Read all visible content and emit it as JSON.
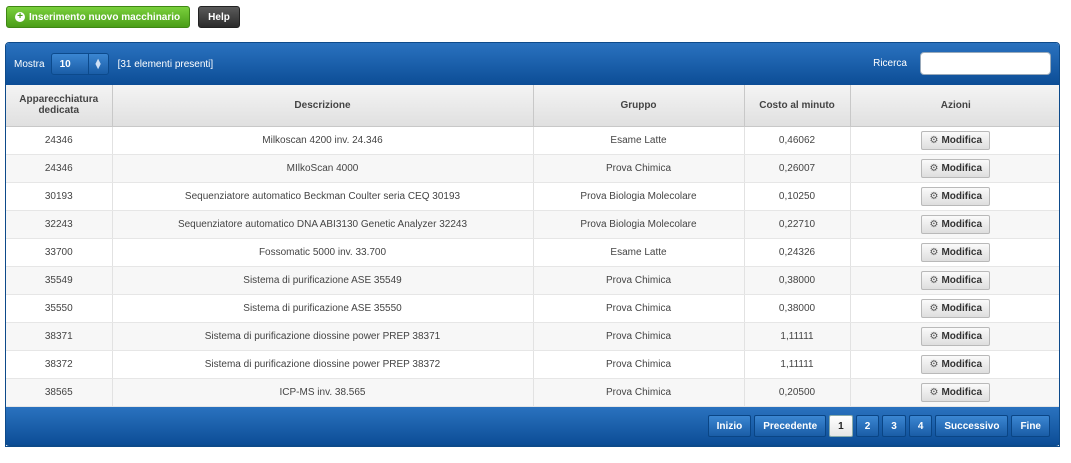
{
  "toolbar": {
    "insert_label": "Inserimento nuovo macchinario",
    "help_label": "Help"
  },
  "controls": {
    "show_label": "Mostra",
    "page_size": "10",
    "count_label": "[31 elementi presenti]",
    "search_label": "Ricerca",
    "search_value": ""
  },
  "table": {
    "headers": [
      "Apparecchiatura dedicata",
      "Descrizione",
      "Gruppo",
      "Costo al minuto",
      "Azioni"
    ],
    "action_label": "Modifica",
    "rows": [
      {
        "code": "24346",
        "description": "Milkoscan 4200 inv. 24.346",
        "group": "Esame Latte",
        "cost": "0,46062"
      },
      {
        "code": "24346",
        "description": "MIlkoScan 4000",
        "group": "Prova Chimica",
        "cost": "0,26007"
      },
      {
        "code": "30193",
        "description": "Sequenziatore automatico Beckman Coulter seria CEQ 30193",
        "group": "Prova Biologia Molecolare",
        "cost": "0,10250"
      },
      {
        "code": "32243",
        "description": "Sequenziatore automatico DNA ABI3130 Genetic Analyzer 32243",
        "group": "Prova Biologia Molecolare",
        "cost": "0,22710"
      },
      {
        "code": "33700",
        "description": "Fossomatic 5000 inv. 33.700",
        "group": "Esame Latte",
        "cost": "0,24326"
      },
      {
        "code": "35549",
        "description": "Sistema di purificazione ASE 35549",
        "group": "Prova Chimica",
        "cost": "0,38000"
      },
      {
        "code": "35550",
        "description": "Sistema di purificazione ASE 35550",
        "group": "Prova Chimica",
        "cost": "0,38000"
      },
      {
        "code": "38371",
        "description": "Sistema di purificazione diossine power PREP 38371",
        "group": "Prova Chimica",
        "cost": "1,11111"
      },
      {
        "code": "38372",
        "description": "Sistema di purificazione diossine power PREP 38372",
        "group": "Prova Chimica",
        "cost": "1,11111"
      },
      {
        "code": "38565",
        "description": "ICP-MS inv. 38.565",
        "group": "Prova Chimica",
        "cost": "0,20500"
      }
    ]
  },
  "pagination": {
    "first": "Inizio",
    "prev": "Precedente",
    "pages": [
      "1",
      "2",
      "3",
      "4"
    ],
    "active_page": "1",
    "next": "Successivo",
    "last": "Fine"
  },
  "colors": {
    "header_blue": "#0c4d96",
    "insert_green": "#4a9d18",
    "help_dark": "#2b2b2b"
  },
  "icons": {
    "insert": "plus-circle-icon",
    "select": "select-arrows-icon",
    "action": "gear-icon"
  }
}
